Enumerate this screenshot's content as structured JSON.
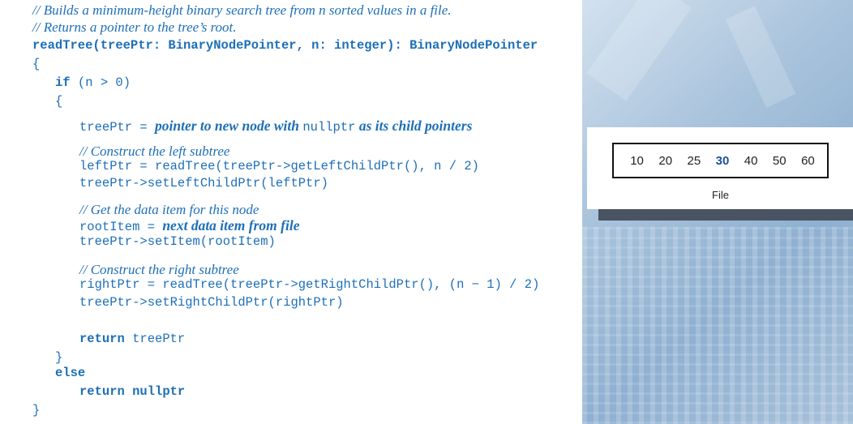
{
  "code": {
    "comment_1": "// Builds a minimum-height binary search tree from n sorted values in a file.",
    "comment_2": "// Returns a pointer to the tree’s root.",
    "signature": "readTree(treePtr: BinaryNodePointer, n: integer): BinaryNodePointer",
    "brace_open": "{",
    "if_kw": "if",
    "if_cond": " (n > 0)",
    "inner_brace_open": "{",
    "alloc_lhs": "treePtr = ",
    "alloc_prose_1": "pointer to new node with ",
    "alloc_code": "nullptr",
    "alloc_prose_2": " as its child pointers",
    "comment_left": "// Construct the left subtree",
    "left_call": "leftPtr = readTree(treePtr->getLeftChildPtr(), n / 2)",
    "left_set": "treePtr->setLeftChildPtr(leftPtr)",
    "comment_data": "// Get the data item for this node",
    "root_lhs": "rootItem = ",
    "root_prose": "next data item from file",
    "set_item": "treePtr->setItem(rootItem)",
    "comment_right": "// Construct the right subtree",
    "right_call": "rightPtr = readTree(treePtr->getRightChildPtr(), (n − 1) / 2)",
    "right_set": "treePtr->setRightChildPtr(rightPtr)",
    "return_kw": "return",
    "return_val": " treePtr",
    "inner_brace_close": "}",
    "else_kw": "else",
    "else_return": "return nullptr",
    "brace_close": "}"
  },
  "file": {
    "values": [
      "10",
      "20",
      "25",
      "30",
      "40",
      "50",
      "60"
    ],
    "highlighted_value": "30",
    "label": "File",
    "highlight_color": "#1d4f9c"
  },
  "colors": {
    "code_text": "#1d6fb8",
    "background_photo": "#8fb0d1"
  }
}
